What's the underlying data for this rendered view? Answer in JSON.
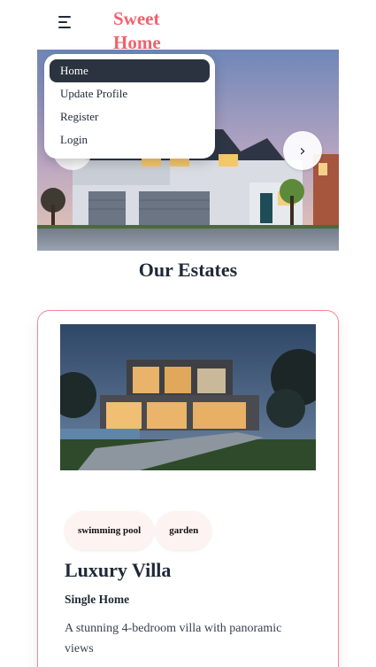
{
  "header": {
    "brand": "Sweet Home",
    "menu_icon": "hamburger-menu-icon"
  },
  "menu": {
    "items": [
      {
        "label": "Home",
        "active": true
      },
      {
        "label": "Update Profile",
        "active": false
      },
      {
        "label": "Register",
        "active": false
      },
      {
        "label": "Login",
        "active": false
      }
    ]
  },
  "hero": {
    "next_glyph": "›",
    "next_icon": "chevron-right-icon",
    "prev_icon": "chevron-left-icon"
  },
  "estates": {
    "title": "Our Estates",
    "card": {
      "tags": [
        "swimming pool",
        "garden"
      ],
      "title": "Luxury Villa",
      "type": "Single Home",
      "description": "A stunning 4-bedroom villa with panoramic views"
    }
  },
  "colors": {
    "brand": "#f0626e",
    "card_border": "#f08a93",
    "menu_active_bg": "#2b3340"
  }
}
